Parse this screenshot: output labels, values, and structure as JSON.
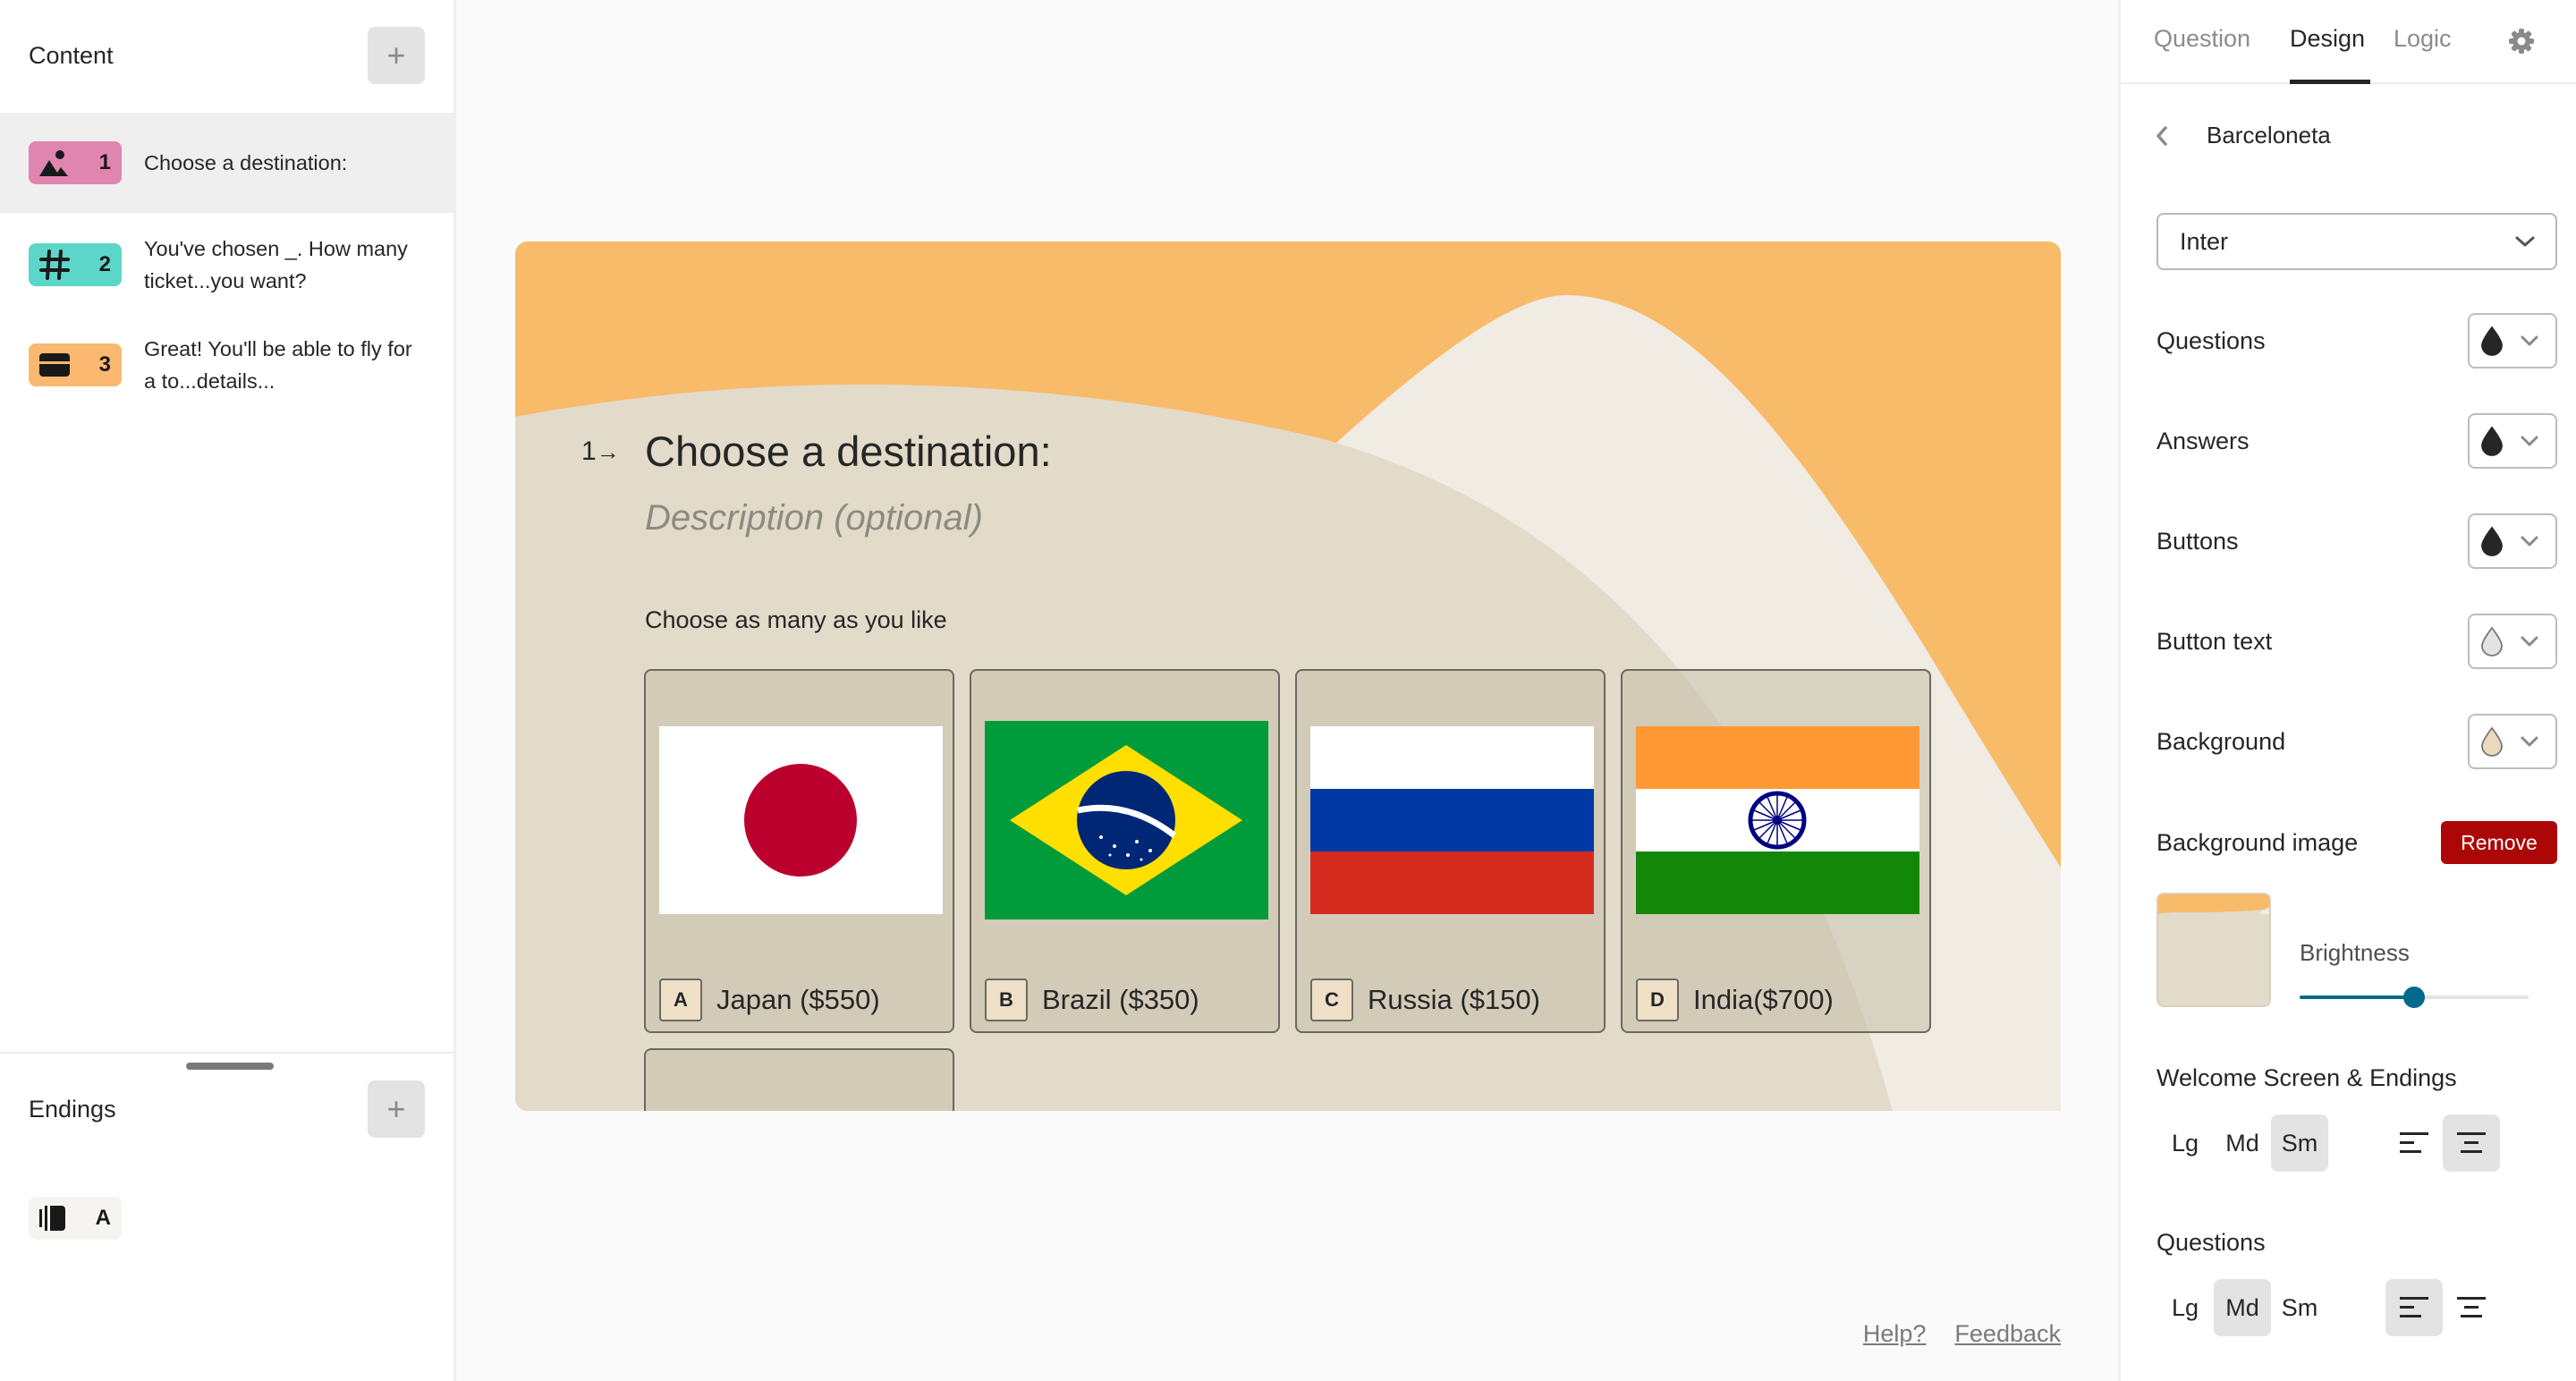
{
  "left": {
    "content_title": "Content",
    "add_label": "+",
    "questions": [
      {
        "num": "1",
        "text": "Choose a destination:",
        "icon": "picture-choice-icon",
        "color": "#e085af",
        "selected": true
      },
      {
        "num": "2",
        "text": "You've chosen _. How many ticket...you want?",
        "icon": "number-hash-icon",
        "color": "#5bd6c9",
        "selected": false
      },
      {
        "num": "3",
        "text": "Great! You'll be able to fly for a to...details...",
        "icon": "payment-card-icon",
        "color": "#fbb870",
        "selected": false
      }
    ],
    "endings_title": "Endings",
    "ending_item": {
      "letter": "A",
      "icon": "ending-screen-icon"
    }
  },
  "canvas": {
    "question_number": "1",
    "question_title": "Choose a destination:",
    "description_placeholder": "Description (optional)",
    "hint": "Choose as many as you like",
    "colors": {
      "orange": "#f8bb69",
      "sand": "#e2dbc9",
      "cream": "#f0ebe3"
    },
    "choices": [
      {
        "key": "A",
        "label": "Japan ($550)",
        "flag": "japan-flag"
      },
      {
        "key": "B",
        "label": "Brazil ($350)",
        "flag": "brazil-flag"
      },
      {
        "key": "C",
        "label": "Russia ($150)",
        "flag": "russia-flag"
      },
      {
        "key": "D",
        "label": "India($700)",
        "flag": "india-flag"
      }
    ]
  },
  "footer": {
    "help": "Help?",
    "feedback": "Feedback"
  },
  "right": {
    "tabs": [
      {
        "label": "Question",
        "active": false
      },
      {
        "label": "Design",
        "active": true
      },
      {
        "label": "Logic",
        "active": false
      }
    ],
    "theme_name": "Barceloneta",
    "font_select": "Inter",
    "color_settings": [
      {
        "label": "Questions",
        "color": "#262627"
      },
      {
        "label": "Answers",
        "color": "#262627"
      },
      {
        "label": "Buttons",
        "color": "#262627"
      },
      {
        "label": "Button text",
        "color": "#e3e3e3"
      },
      {
        "label": "Background",
        "color": "#ead9bd"
      }
    ],
    "background_image_label": "Background image",
    "remove_label": "Remove",
    "remove_color": "#ad0606",
    "brightness_label": "Brightness",
    "brightness_percent": 50,
    "slider_color": "#00698c",
    "welcome_endings": {
      "title": "Welcome Screen & Endings",
      "sizes": [
        "Lg",
        "Md",
        "Sm"
      ],
      "selected_size": "Sm",
      "alignment": "center"
    },
    "questions_layout": {
      "title": "Questions",
      "sizes": [
        "Lg",
        "Md",
        "Sm"
      ],
      "selected_size": "Md",
      "alignment": "left"
    }
  }
}
